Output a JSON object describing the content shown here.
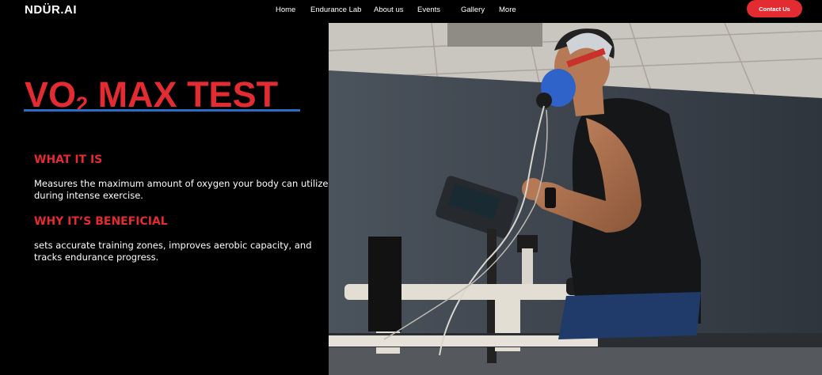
{
  "header": {
    "logo": "NDÜR.AI",
    "nav": [
      "Home",
      "Endurance Lab",
      "About us",
      "Events",
      "Gallery",
      "More"
    ],
    "contact_label": "Contact Us"
  },
  "hero": {
    "title_prefix": "VO",
    "title_sub": "2",
    "title_suffix": " MAX TEST",
    "sections": [
      {
        "heading": "WHAT IT IS",
        "text": "Measures the maximum amount of oxygen your body can utilize during intense exercise."
      },
      {
        "heading": "WHY IT’S BENEFICIAL",
        "text": "sets accurate training zones, improves aerobic capacity, and tracks endurance progress."
      }
    ]
  },
  "colors": {
    "accent_red": "#e32b32",
    "underline_blue": "#2b6cc4",
    "background": "#000000"
  },
  "photo": {
    "icon": "treadmill-vo2-test-photo"
  }
}
